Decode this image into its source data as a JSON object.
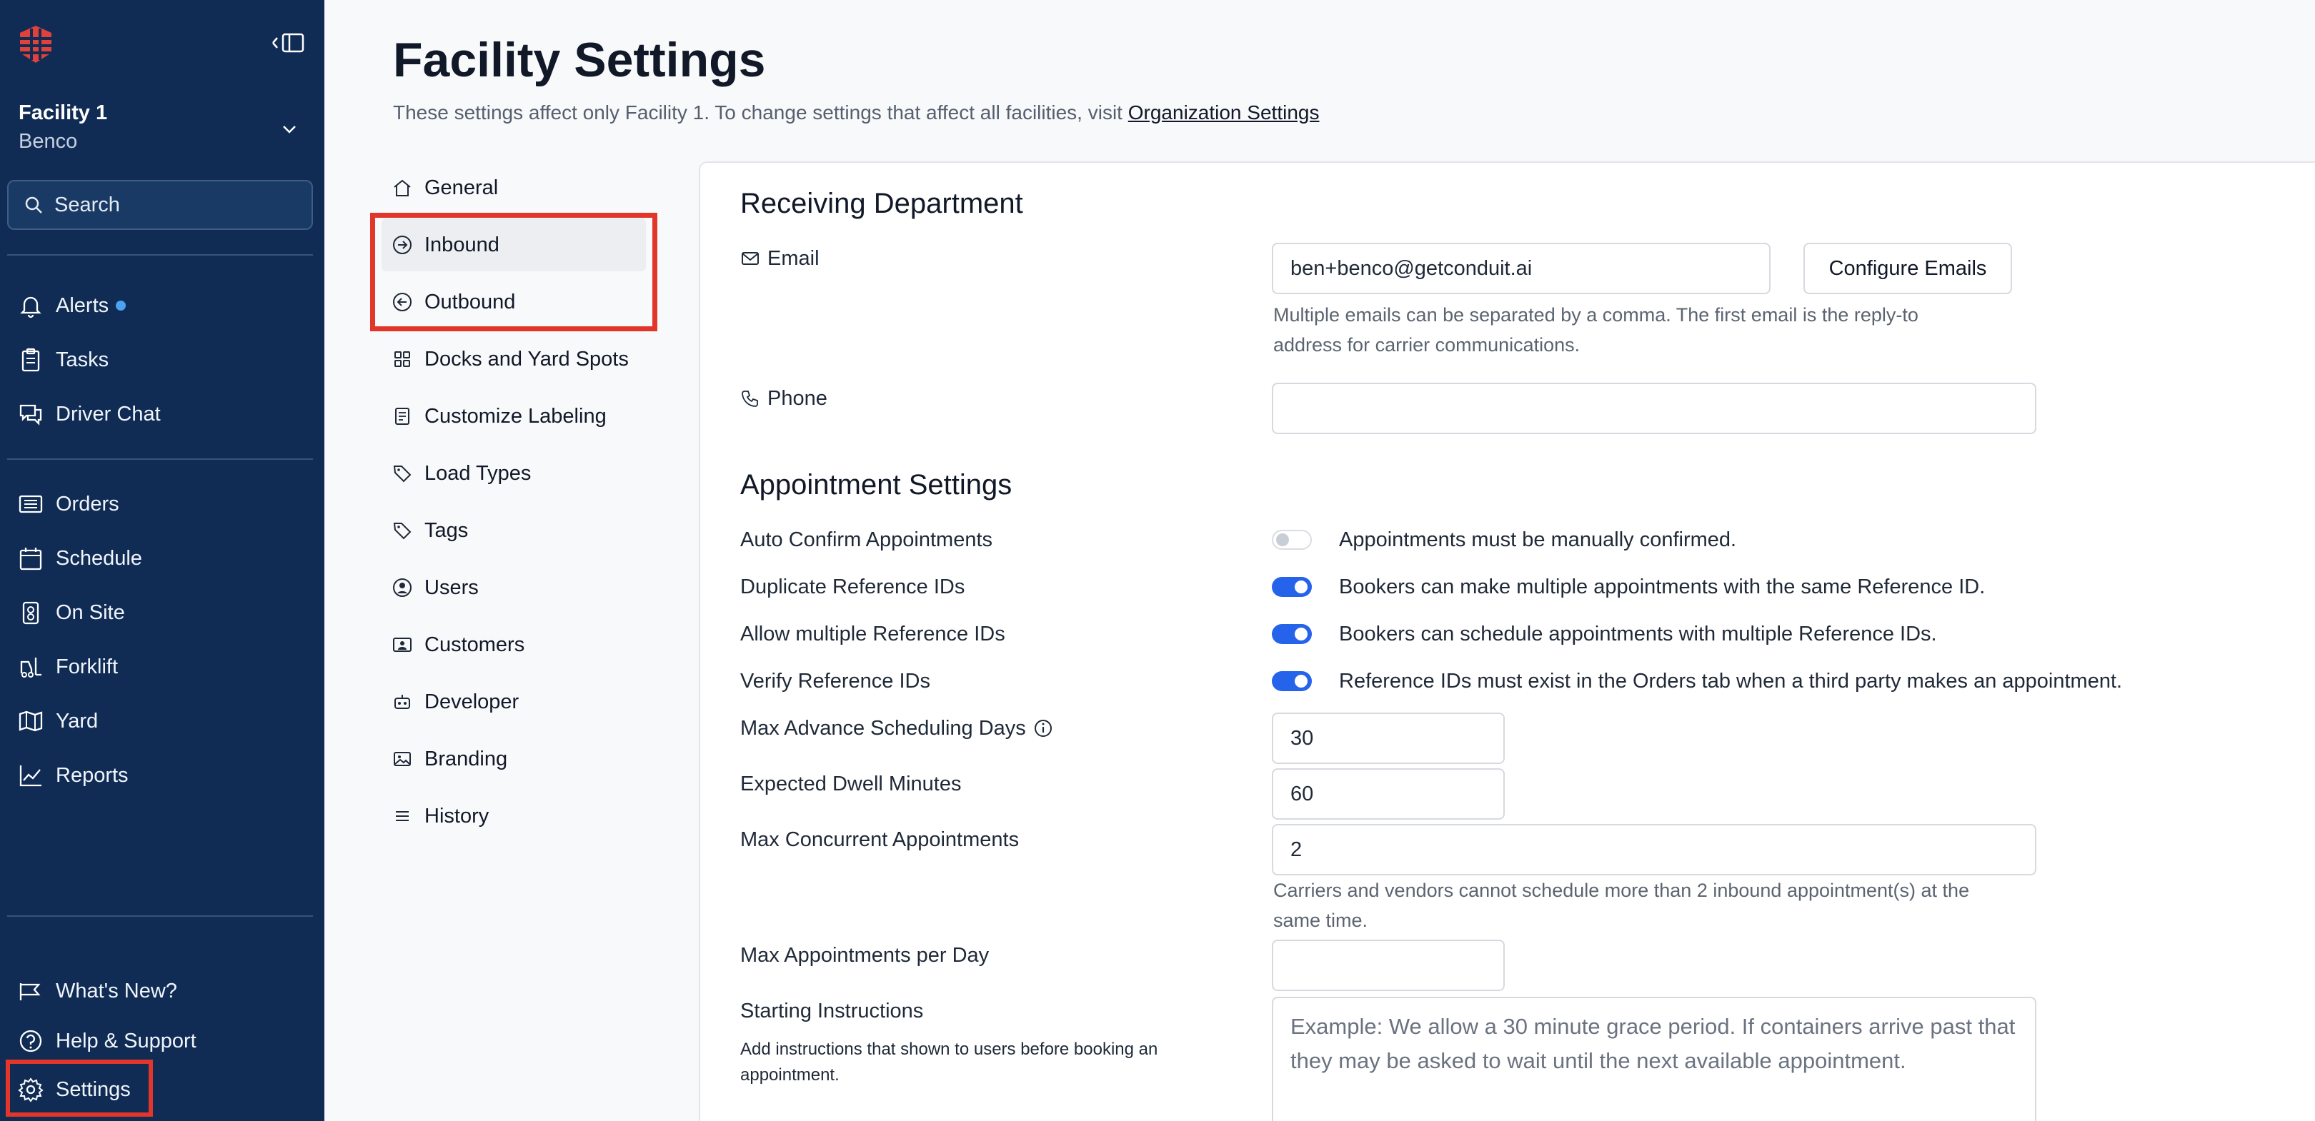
{
  "sidebar": {
    "facility_name": "Facility 1",
    "facility_org": "Benco",
    "search_label": "Search",
    "nav_top": [
      {
        "label": "Alerts",
        "icon": "bell-icon"
      },
      {
        "label": "Tasks",
        "icon": "clipboard-icon"
      },
      {
        "label": "Driver Chat",
        "icon": "chat-icon"
      }
    ],
    "nav_main": [
      {
        "label": "Orders",
        "icon": "orders-icon"
      },
      {
        "label": "Schedule",
        "icon": "calendar-icon"
      },
      {
        "label": "On Site",
        "icon": "badge-icon"
      },
      {
        "label": "Forklift",
        "icon": "forklift-icon"
      },
      {
        "label": "Yard",
        "icon": "map-icon"
      },
      {
        "label": "Reports",
        "icon": "chart-icon"
      }
    ],
    "nav_bottom": [
      {
        "label": "What's New?",
        "icon": "megaphone-icon"
      },
      {
        "label": "Help & Support",
        "icon": "help-icon"
      },
      {
        "label": "Settings",
        "icon": "gear-icon"
      }
    ]
  },
  "header": {
    "title": "Facility Settings",
    "subtitle": "These settings affect only Facility 1. To change settings that affect all facilities, visit ",
    "subtitle_link": "Organization Settings"
  },
  "settings_nav": [
    {
      "label": "General",
      "icon": "home-icon"
    },
    {
      "label": "Inbound",
      "icon": "arrow-right-circle-icon"
    },
    {
      "label": "Outbound",
      "icon": "arrow-left-circle-icon"
    },
    {
      "label": "Docks and Yard Spots",
      "icon": "grid-icon"
    },
    {
      "label": "Customize Labeling",
      "icon": "document-icon"
    },
    {
      "label": "Load Types",
      "icon": "tag-icon"
    },
    {
      "label": "Tags",
      "icon": "tag-icon"
    },
    {
      "label": "Users",
      "icon": "user-icon"
    },
    {
      "label": "Customers",
      "icon": "id-card-icon"
    },
    {
      "label": "Developer",
      "icon": "robot-icon"
    },
    {
      "label": "Branding",
      "icon": "image-icon"
    },
    {
      "label": "History",
      "icon": "list-icon"
    }
  ],
  "receiving": {
    "title": "Receiving Department",
    "email_label": "Email",
    "email_value": "ben+benco@getconduit.ai",
    "configure_button": "Configure Emails",
    "email_help_1": "Multiple emails can be separated by a comma. The first email is the reply-to",
    "email_help_2": "address for carrier communications.",
    "phone_label": "Phone",
    "phone_value": ""
  },
  "appointments": {
    "title": "Appointment Settings",
    "toggles": [
      {
        "label": "Auto Confirm Appointments",
        "enabled": false,
        "text": "Appointments must be manually confirmed."
      },
      {
        "label": "Duplicate Reference IDs",
        "enabled": true,
        "text": "Bookers can make multiple appointments with the same Reference ID."
      },
      {
        "label": "Allow multiple Reference IDs",
        "enabled": true,
        "text": "Bookers can schedule appointments with multiple Reference IDs."
      },
      {
        "label": "Verify Reference IDs",
        "enabled": true,
        "text": "Reference IDs must exist in the Orders tab when a third party makes an appointment."
      }
    ],
    "max_advance_label": "Max Advance Scheduling Days",
    "max_advance_value": "30",
    "dwell_label": "Expected Dwell Minutes",
    "dwell_value": "60",
    "concurrent_label": "Max Concurrent Appointments",
    "concurrent_value": "2",
    "concurrent_help_1": "Carriers and vendors cannot schedule more than 2 inbound appointment(s) at the",
    "concurrent_help_2": "same time.",
    "per_day_label": "Max Appointments per Day",
    "per_day_value": "",
    "instructions_label": "Starting Instructions",
    "instructions_sub": "Add instructions that shown to users before booking an appointment.",
    "instructions_placeholder": "Example: We allow a 30 minute grace period. If containers arrive past that they may be asked to wait until the next available appointment."
  },
  "colors": {
    "sidebar_bg": "#102c54",
    "accent": "#2563eb",
    "highlight": "#e2362b"
  }
}
